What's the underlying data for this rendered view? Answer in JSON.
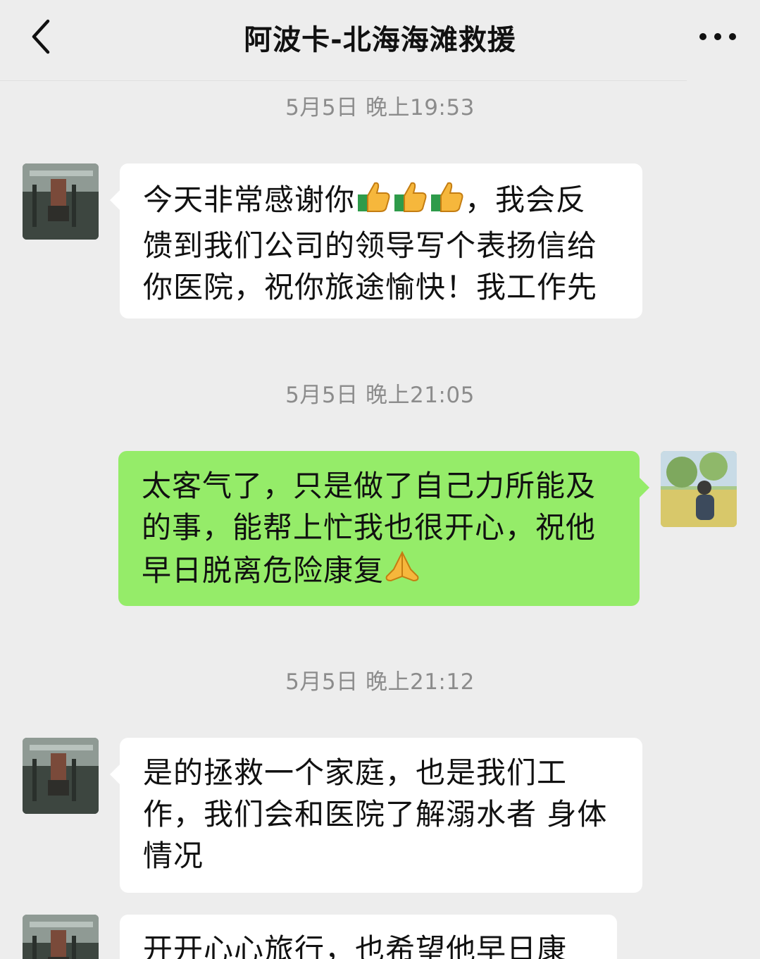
{
  "header": {
    "title": "阿波卡-北海海滩救援",
    "back_icon": "chevron-left-icon",
    "more_icon": "more-dots-icon"
  },
  "messages": [
    {
      "timestamp": "5月5日 晚上19:53",
      "side": "left",
      "lines": [
        "今天非常感谢你",
        "，我会反",
        "馈到我们公司的领导写个表扬信给",
        "你医院，祝你旅途愉快！我工作先"
      ],
      "emojis": [
        "thumbs-up-icon",
        "thumbs-up-icon",
        "thumbs-up-icon"
      ]
    },
    {
      "timestamp": "5月5日 晚上21:05",
      "side": "right",
      "lines": [
        "太客气了，只是做了自己力所能及",
        "的事，能帮上忙我也很开心，祝他",
        "早日脱离危险康复"
      ],
      "emojis": [
        "folded-hands-icon"
      ]
    },
    {
      "timestamp": "5月5日 晚上21:12",
      "side": "left",
      "lines": [
        "是的拯救一个家庭，也是我们工",
        "作，我们会和医院了解溺水者 身体",
        "情况"
      ]
    },
    {
      "side": "left",
      "lines": [
        "开开心心旅行，也希望他早日康"
      ]
    }
  ],
  "colors": {
    "background": "#ededed",
    "bubble_self": "#95ec69",
    "bubble_other": "#ffffff",
    "timestamp": "#8c8c8c"
  }
}
